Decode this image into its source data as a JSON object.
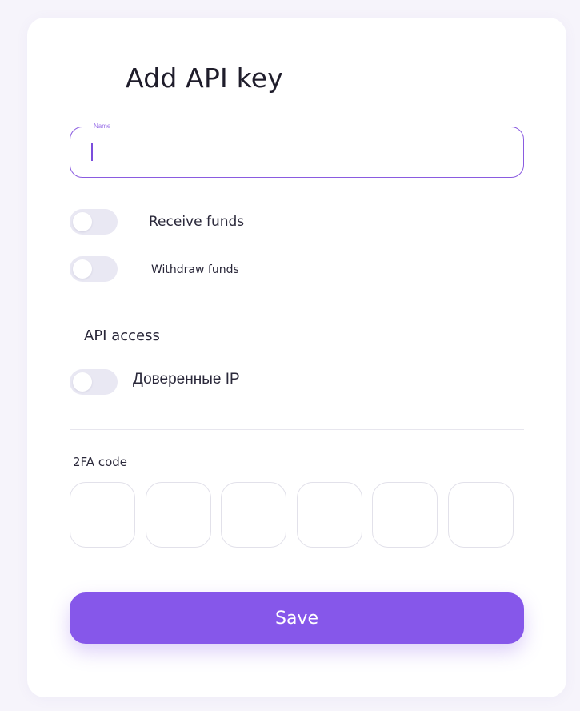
{
  "form": {
    "title": "Add API key",
    "name_field": {
      "label": "Name",
      "value": ""
    },
    "toggles": [
      {
        "label": "Receive funds",
        "on": false
      },
      {
        "label": "Withdraw funds",
        "on": false
      }
    ],
    "api_access": {
      "heading": "API access",
      "trusted_ip": {
        "label": "Доверенные IP",
        "on": false
      }
    },
    "twofa": {
      "label": "2FA code",
      "digits": [
        "",
        "",
        "",
        "",
        "",
        ""
      ]
    },
    "save_label": "Save"
  },
  "colors": {
    "accent": "#8657ea",
    "toggle_off": "#e9e8f3",
    "background": "#f6f4fb"
  }
}
